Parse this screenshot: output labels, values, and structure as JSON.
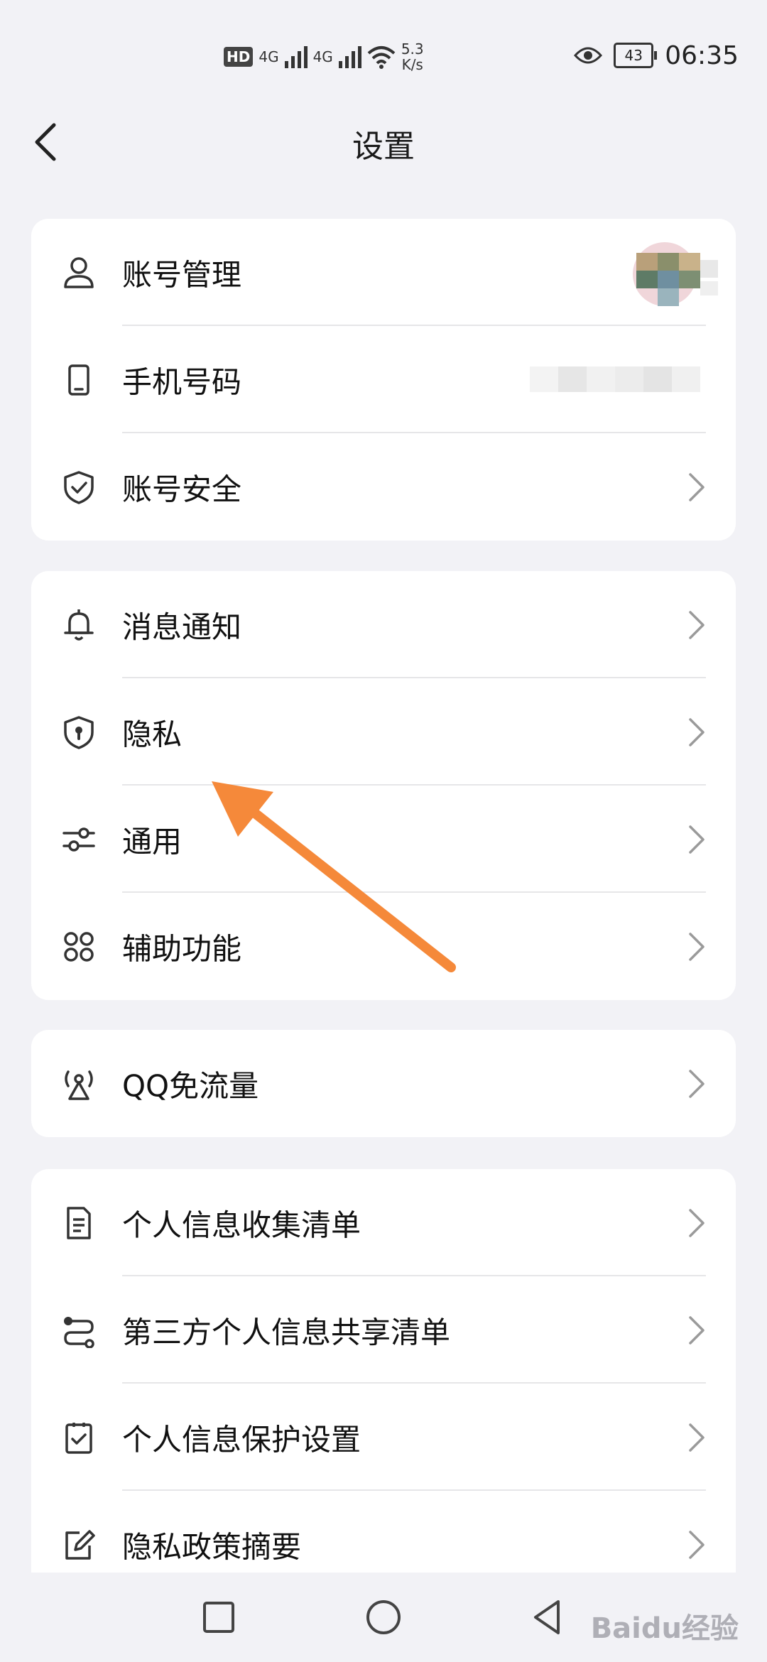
{
  "status_bar": {
    "hd_label": "HD",
    "network_1": "4G",
    "network_2": "4G",
    "speed_value": "5.3",
    "speed_unit": "K/s",
    "battery": "43",
    "time": "06:35"
  },
  "header": {
    "title": "设置"
  },
  "groups": [
    {
      "items": [
        {
          "label": "账号管理",
          "icon": "person-icon",
          "trailing": "avatar"
        },
        {
          "label": "手机号码",
          "icon": "phone-icon",
          "trailing": "blurred-number"
        },
        {
          "label": "账号安全",
          "icon": "shield-check-icon",
          "trailing": "chevron"
        }
      ]
    },
    {
      "items": [
        {
          "label": "消息通知",
          "icon": "bell-icon",
          "trailing": "chevron"
        },
        {
          "label": "隐私",
          "icon": "privacy-shield-icon",
          "trailing": "chevron"
        },
        {
          "label": "通用",
          "icon": "sliders-icon",
          "trailing": "chevron"
        },
        {
          "label": "辅助功能",
          "icon": "grid-icon",
          "trailing": "chevron"
        }
      ]
    },
    {
      "items": [
        {
          "label": "QQ免流量",
          "icon": "signal-tower-icon",
          "trailing": "chevron"
        }
      ]
    },
    {
      "items": [
        {
          "label": "个人信息收集清单",
          "icon": "document-icon",
          "trailing": "chevron"
        },
        {
          "label": "第三方个人信息共享清单",
          "icon": "share-list-icon",
          "trailing": "chevron"
        },
        {
          "label": "个人信息保护设置",
          "icon": "checklist-icon",
          "trailing": "chevron"
        },
        {
          "label": "隐私政策摘要",
          "icon": "edit-icon",
          "trailing": "chevron"
        }
      ]
    }
  ],
  "watermark": "Baidu经验",
  "colors": {
    "background": "#f2f2f6",
    "card": "#ffffff",
    "annotation_arrow": "#f5893a"
  }
}
